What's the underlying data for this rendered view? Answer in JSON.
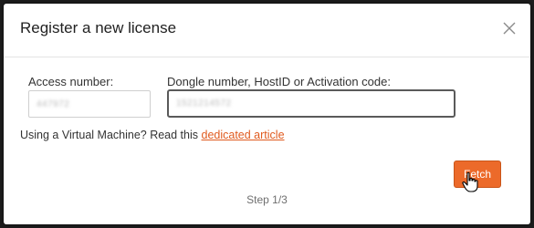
{
  "dialog": {
    "title": "Register a new license"
  },
  "form": {
    "access_label": "Access number:",
    "access_value": "447972",
    "dongle_label": "Dongle number, HostID or Activation code:",
    "dongle_value": "1521214572"
  },
  "vm_notice": {
    "text": "Using a Virtual Machine? Read this ",
    "link_label": "dedicated article"
  },
  "actions": {
    "fetch_label": "Fetch"
  },
  "footer": {
    "step_text": "Step 1/3"
  },
  "colors": {
    "accent": "#ec6a2a",
    "link": "#e05a1e"
  }
}
